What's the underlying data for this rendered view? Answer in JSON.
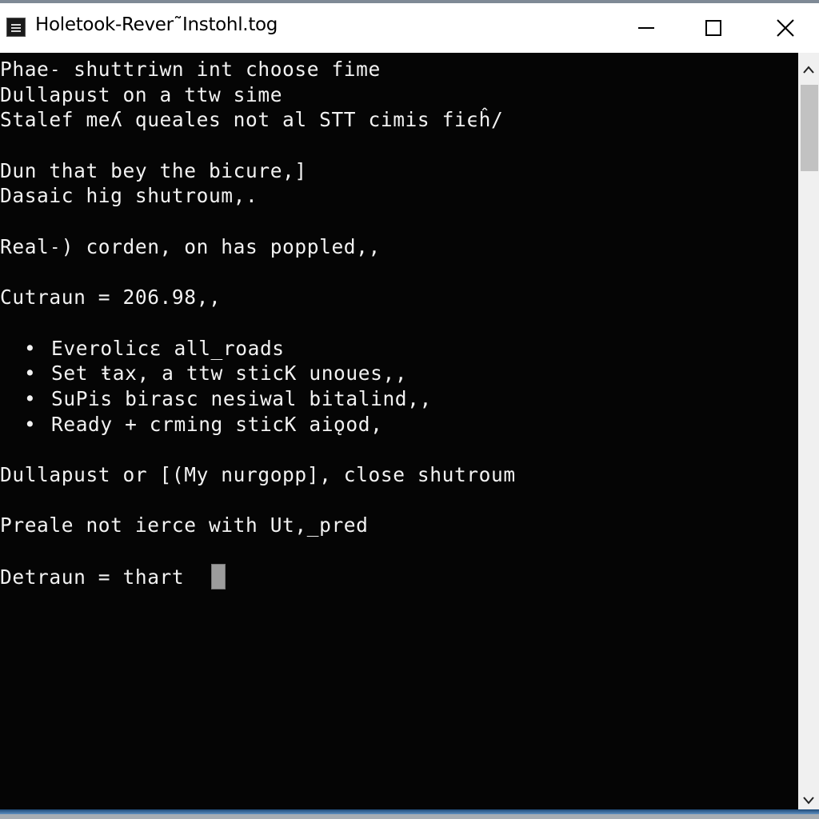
{
  "window": {
    "title": "Holetook-Rever˜Instohl.tog",
    "controls": {
      "minimize_icon": "minimize-icon",
      "maximize_icon": "maximize-icon",
      "close_icon": "close-icon"
    }
  },
  "console": {
    "lines": [
      "Phae˗ shuttriwn int choose fime",
      "Dullapust on a ttw sime",
      "Stalef meʎ queales not al STT cimis fiϵĥ/",
      "",
      "Dun that bey the bicure,]",
      "Dasaic hig shutroum,.",
      "",
      "Real˗) corden, on has poppled,,",
      "",
      "Cutraun = 206.98,,",
      ""
    ],
    "bullets": [
      "Everolicε all_roads",
      "Set ŧax, a ttw sticK unoues,,",
      "SuPis birasc nesiwal bitalind,,",
      "Ready + crming sticK aiǫod,"
    ],
    "bullet_char": "•",
    "after_lines": [
      "",
      "Dullapust or [(My nurgopp], close shutroum",
      "",
      "Preale not ierce with Ut,_pred",
      ""
    ],
    "prompt_line": "Detraun = thart"
  },
  "scrollbar": {
    "up_icon": "chevron-up-icon",
    "down_icon": "chevron-down-icon"
  }
}
